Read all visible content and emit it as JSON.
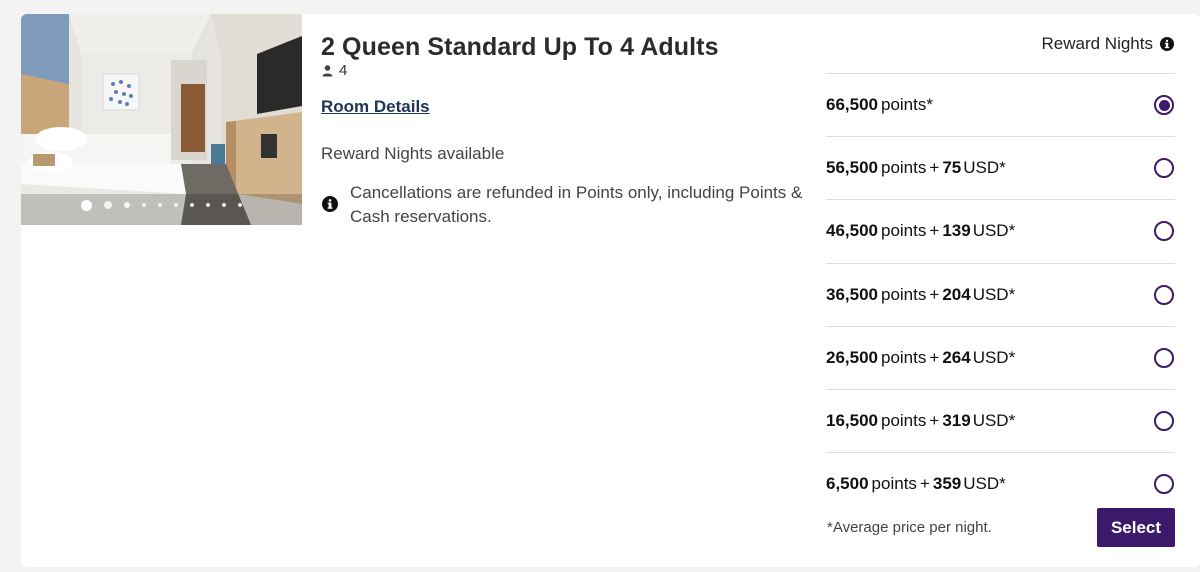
{
  "room": {
    "title": "2 Queen Standard Up To 4 Adults",
    "guests": "4",
    "details_link": "Room Details",
    "availability": "Reward Nights available",
    "cancellation": "Cancellations are refunded in Points only, including Points & Cash reservations."
  },
  "rate_type": "Reward Nights",
  "rates": [
    {
      "points": "66,500",
      "word": "points*",
      "plus": "",
      "usd": "",
      "suffix": "",
      "selected": true
    },
    {
      "points": "56,500",
      "word": "points",
      "plus": "+",
      "usd": "75",
      "suffix": "USD*",
      "selected": false
    },
    {
      "points": "46,500",
      "word": "points",
      "plus": "+",
      "usd": "139",
      "suffix": "USD*",
      "selected": false
    },
    {
      "points": "36,500",
      "word": "points",
      "plus": "+",
      "usd": "204",
      "suffix": "USD*",
      "selected": false
    },
    {
      "points": "26,500",
      "word": "points",
      "plus": "+",
      "usd": "264",
      "suffix": "USD*",
      "selected": false
    },
    {
      "points": "16,500",
      "word": "points",
      "plus": "+",
      "usd": "319",
      "suffix": "USD*",
      "selected": false
    },
    {
      "points": "6,500",
      "word": "points",
      "plus": "+",
      "usd": "359",
      "suffix": "USD*",
      "selected": false
    }
  ],
  "footnote": "*Average price per night.",
  "select_label": "Select",
  "gallery": {
    "image_count": 10,
    "current": 1
  },
  "colors": {
    "accent": "#3b1a6b",
    "link": "#1d3557"
  }
}
